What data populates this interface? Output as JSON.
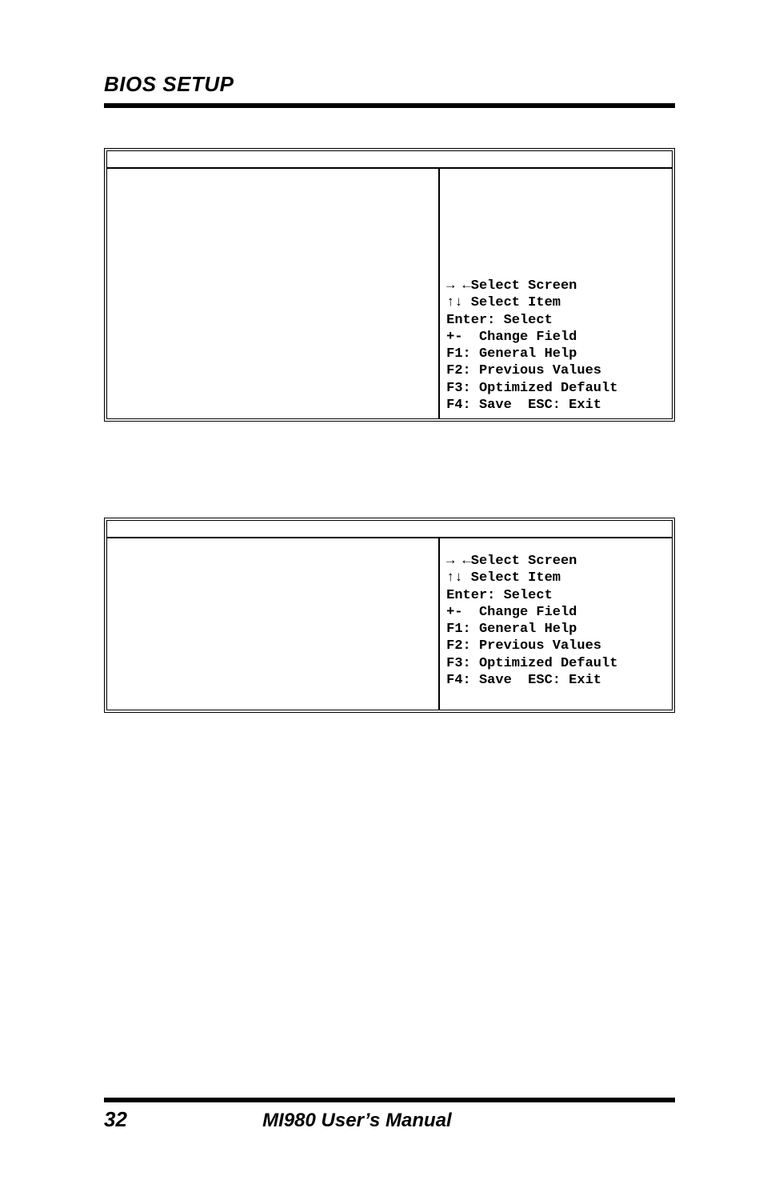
{
  "header": "BIOS SETUP",
  "help_block": {
    "line1": "→ ←Select Screen",
    "line2": "↑↓ Select Item",
    "line3": "Enter: Select",
    "line4": "+-  Change Field",
    "line5": "F1: General Help",
    "line6": "F2: Previous Values",
    "line7": "F3: Optimized Default",
    "line8": "F4: Save  ESC: Exit"
  },
  "footer": {
    "page": "32",
    "title": "MI980 User’s Manual"
  }
}
